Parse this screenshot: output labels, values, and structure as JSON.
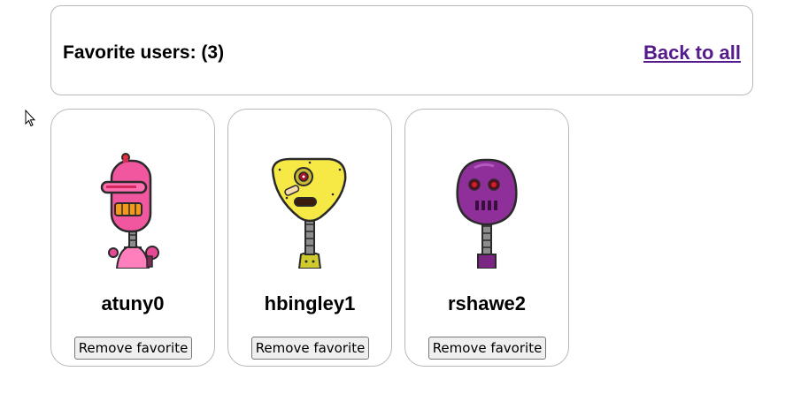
{
  "header": {
    "title": "Favorite users: (3)",
    "back_link": "Back to all"
  },
  "users": [
    {
      "username": "atuny0",
      "remove_label": "Remove favorite",
      "avatar": "pink-robot-avatar",
      "color": "#f0579f"
    },
    {
      "username": "hbingley1",
      "remove_label": "Remove favorite",
      "avatar": "yellow-robot-avatar",
      "color": "#f6e945"
    },
    {
      "username": "rshawe2",
      "remove_label": "Remove favorite",
      "avatar": "purple-robot-avatar",
      "color": "#8f2f9a"
    }
  ]
}
